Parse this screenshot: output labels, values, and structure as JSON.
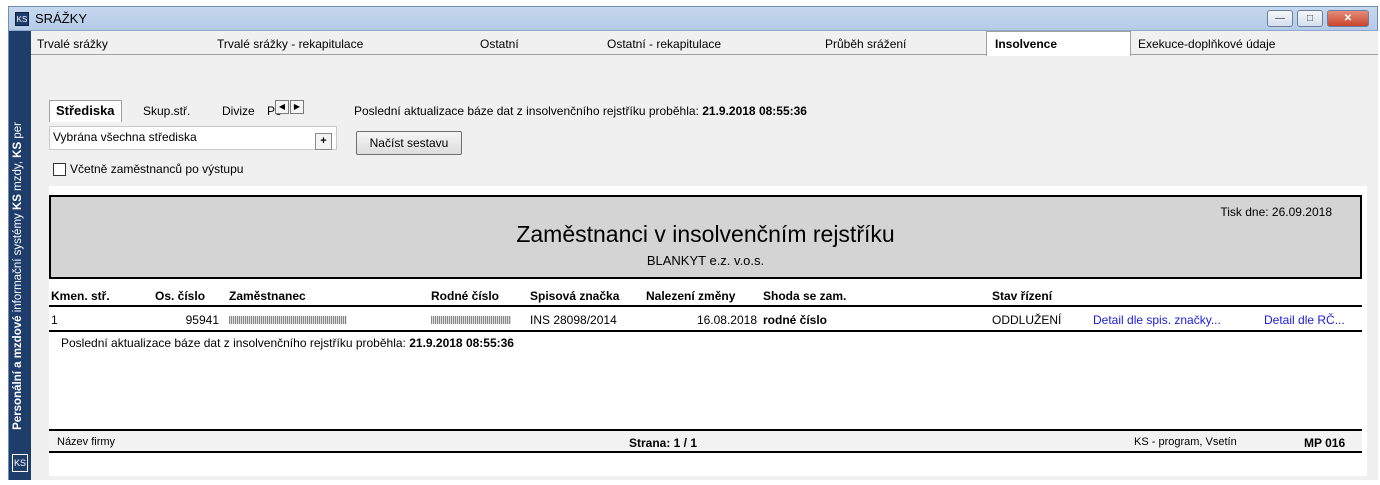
{
  "window": {
    "title": "SRÁŽKY",
    "app_icon": "KS",
    "buttons": [
      "minimize",
      "maximize",
      "close"
    ]
  },
  "sidebar": {
    "text_parts": [
      "Personální a mzdové",
      " informační systémy ",
      "KS",
      " mzdy, ",
      "KS",
      " per"
    ],
    "logo": "KS"
  },
  "tabs": [
    {
      "label": "Trvalé srážky"
    },
    {
      "label": "Trvalé srážky - rekapitulace"
    },
    {
      "label": "Ostatní"
    },
    {
      "label": "Ostatní - rekapitulace"
    },
    {
      "label": "Průběh srážení"
    },
    {
      "label": "Insolvence",
      "active": true
    },
    {
      "label": "Exekuce-doplňkové údaje"
    }
  ],
  "filter": {
    "subtabs": [
      "Střediska",
      "Skup.stř.",
      "Divize",
      "Po"
    ],
    "selected": "Vybrána všechna střediska",
    "plus": "+",
    "checkbox_label": "Včetně zaměstnanců po výstupu",
    "checkbox_checked": false
  },
  "update_info": {
    "prefix": "Poslední aktualizace báze dat z insolvenčního rejstříku proběhla:",
    "datetime": "21.9.2018 08:55:36"
  },
  "load_button": "Načíst sestavu",
  "report": {
    "print_date": "Tisk dne: 26.09.2018",
    "title": "Zaměstnanci v insolvenčním rejstříku",
    "company": "BLANKYT e.z. v.o.s.",
    "columns": [
      "Kmen. stř.",
      "Os. číslo",
      "Zaměstnanec",
      "Rodné číslo",
      "Spisová značka",
      "Nalezení změny",
      "Shoda se zam.",
      "Stav řízení"
    ],
    "rows": [
      {
        "kmen": "1",
        "os_cislo": "95941",
        "zamestnanec": "",
        "rodne_cislo": "",
        "spisova_znacka": "INS 28098/2014",
        "nalezeni": "16.08.2018",
        "shoda": "rodné číslo",
        "stav": "ODDLUŽENÍ",
        "link1": "Detail dle spis. značky...",
        "link2": "Detail dle RČ..."
      }
    ],
    "footer_update_prefix": "Poslední aktualizace báze dat z insolvenčního rejstříku proběhla:",
    "footer_update_datetime": "21.9.2018 08:55:36",
    "page_footer": {
      "firm": "Název firmy",
      "page": "Strana: 1 / 1",
      "program": "KS - program, Vsetín",
      "code": "MP 016"
    }
  }
}
